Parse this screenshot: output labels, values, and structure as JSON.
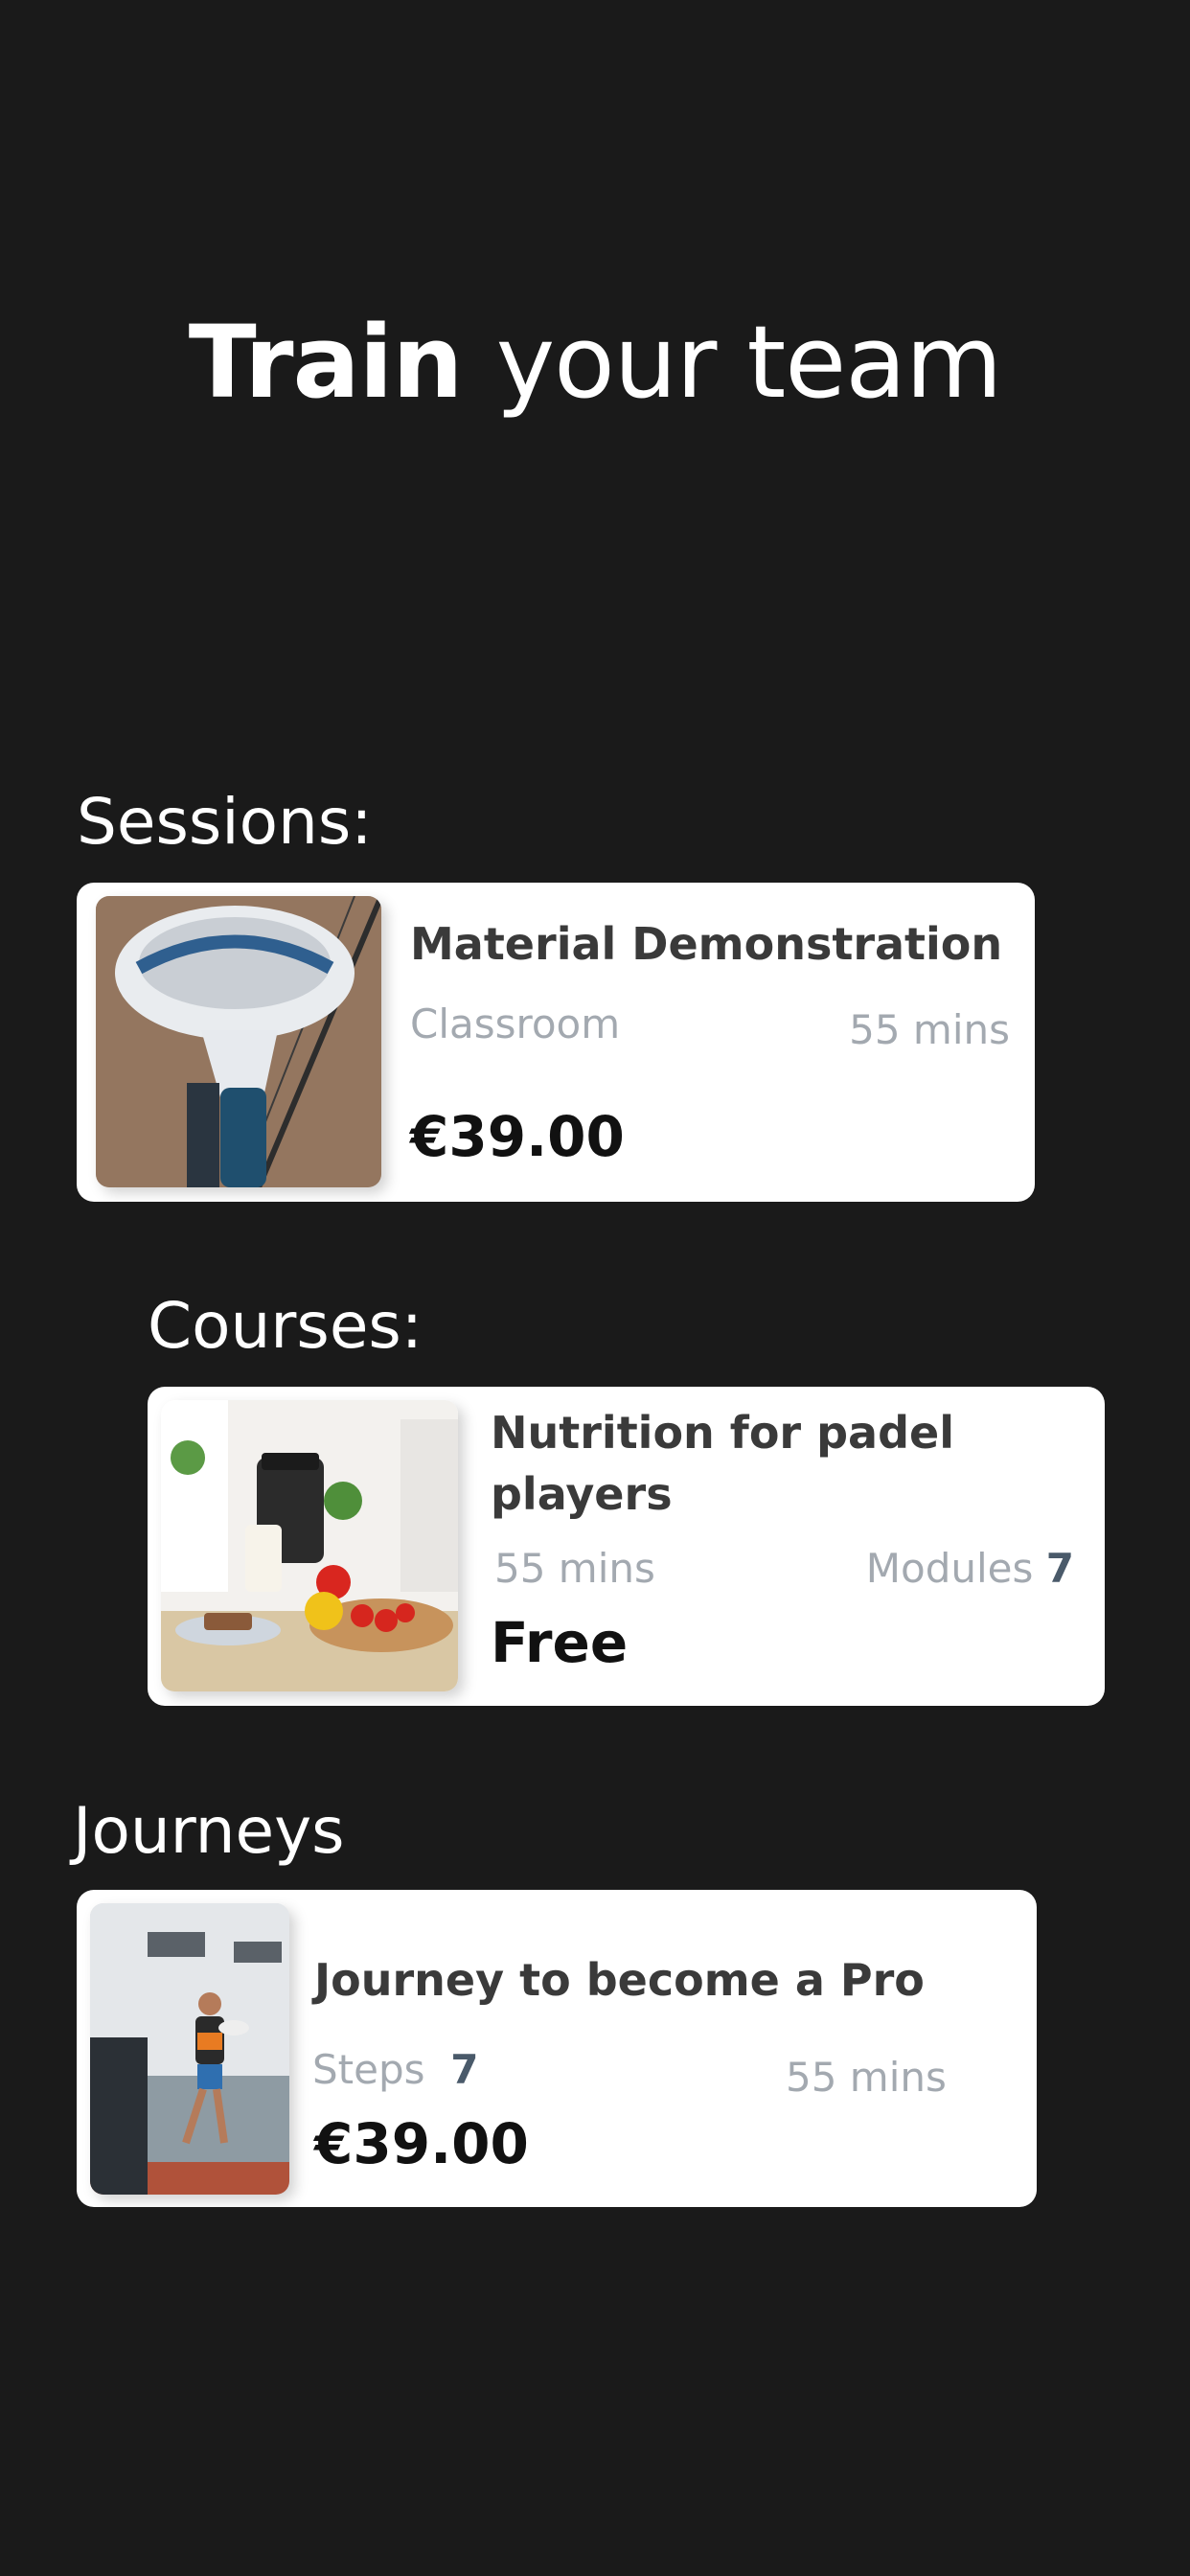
{
  "hero": {
    "title_bold": "Train",
    "title_rest": "your team"
  },
  "sessions": {
    "label": "Sessions:",
    "card": {
      "title": "Material Demonstration",
      "type": "Classroom",
      "duration": "55 mins",
      "price": "€39.00",
      "image_icon": "padel-racket-image"
    }
  },
  "courses": {
    "label": "Courses:",
    "card": {
      "title": "Nutrition for padel players",
      "duration": "55 mins",
      "modules_label": "Modules",
      "modules_count": "7",
      "price": "Free",
      "image_icon": "healthy-food-image"
    }
  },
  "journeys": {
    "label": "Journeys",
    "card": {
      "title": "Journey to become a Pro",
      "steps_label": "Steps",
      "steps_count": "7",
      "duration": "55 mins",
      "price": "€39.00",
      "image_icon": "padel-player-image"
    }
  },
  "colors": {
    "background": "#1a1a1a",
    "card": "#ffffff",
    "muted_text": "#a3a9b0",
    "count_text": "#4a5a6a"
  }
}
